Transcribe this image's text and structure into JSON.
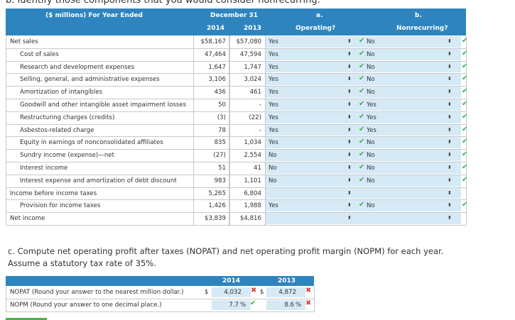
{
  "top_text": "b. Identify those components that you would consider nonrecurring.",
  "header": {
    "col_label": "($ millions) For Year Ended",
    "period": "December 31",
    "year1": "2014",
    "year2": "2013",
    "col_a": "a.",
    "col_a_sub": "Operating?",
    "col_b": "b.",
    "col_b_sub": "Nonrecurring?"
  },
  "rows": [
    {
      "label": "Net sales",
      "v2014": "$58,167",
      "v2013": "$57,080",
      "op": "Yes",
      "nr": "No"
    },
    {
      "label": "Cost of sales",
      "v2014": "47,464",
      "v2013": "47,594",
      "op": "Yes",
      "nr": "No"
    },
    {
      "label": "Research and development expenses",
      "v2014": "1,647",
      "v2013": "1,747",
      "op": "Yes",
      "nr": "No"
    },
    {
      "label": "Selling, general, and administrative expenses",
      "v2014": "3,106",
      "v2013": "3,024",
      "op": "Yes",
      "nr": "No"
    },
    {
      "label": "Amortization of intangibles",
      "v2014": "436",
      "v2013": "461",
      "op": "Yes",
      "nr": "No"
    },
    {
      "label": "Goodwill and other intangible asset impairment losses",
      "v2014": "50",
      "v2013": "-",
      "op": "Yes",
      "nr": "Yes"
    },
    {
      "label": "Restructuring charges (credits)",
      "v2014": "(3)",
      "v2013": "(22)",
      "op": "Yes",
      "nr": "Yes"
    },
    {
      "label": "Asbestos-related charge",
      "v2014": "78",
      "v2013": "-",
      "op": "Yes",
      "nr": "Yes"
    },
    {
      "label": "Equity in earnings of nonconsolidated affiliates",
      "v2014": "835",
      "v2013": "1,034",
      "op": "Yes",
      "nr": "No"
    },
    {
      "label": "Sundry income (expense)—net",
      "v2014": "(27)",
      "v2013": "2,554",
      "op": "No",
      "nr": "No"
    },
    {
      "label": "Interest income",
      "v2014": "51",
      "v2013": "41",
      "op": "No",
      "nr": "No"
    },
    {
      "label": "Interest expense and amortization of debt discount",
      "v2014": "983",
      "v2013": "1,101",
      "op": "No",
      "nr": "No"
    },
    {
      "label": "Income before income taxes",
      "v2014": "5,265",
      "v2013": "6,804",
      "op": "",
      "nr": ""
    },
    {
      "label": "Provision for income taxes",
      "v2014": "1,426",
      "v2013": "1,988",
      "op": "Yes",
      "nr": "No"
    },
    {
      "label": "Net income",
      "v2014": "$3,839",
      "v2013": "$4,816",
      "op": "",
      "nr": ""
    }
  ],
  "part_c": {
    "question_line1": "c. Compute net operating profit after taxes (NOPAT) and net operating profit margin (NOPM) for each year.",
    "question_line2": "Assume a statutory tax rate of 35%.",
    "year1": "2014",
    "year2": "2013",
    "nopat_label": "NOPAT (Round your answer to the nearest million dollar.)",
    "nopm_label": "NOPM (Round your answer to one decimal place.)",
    "dollar": "$",
    "nopat_2014": "4,032",
    "nopat_2013": "4,872",
    "nopm_2014": "7.7",
    "nopm_2013": "8.6",
    "pct": "%"
  },
  "colors": {
    "header_blue": "#2e84bf",
    "cell_blue": "#d6eaf6",
    "check_green": "#3db04b",
    "x_red": "#e0463c"
  }
}
